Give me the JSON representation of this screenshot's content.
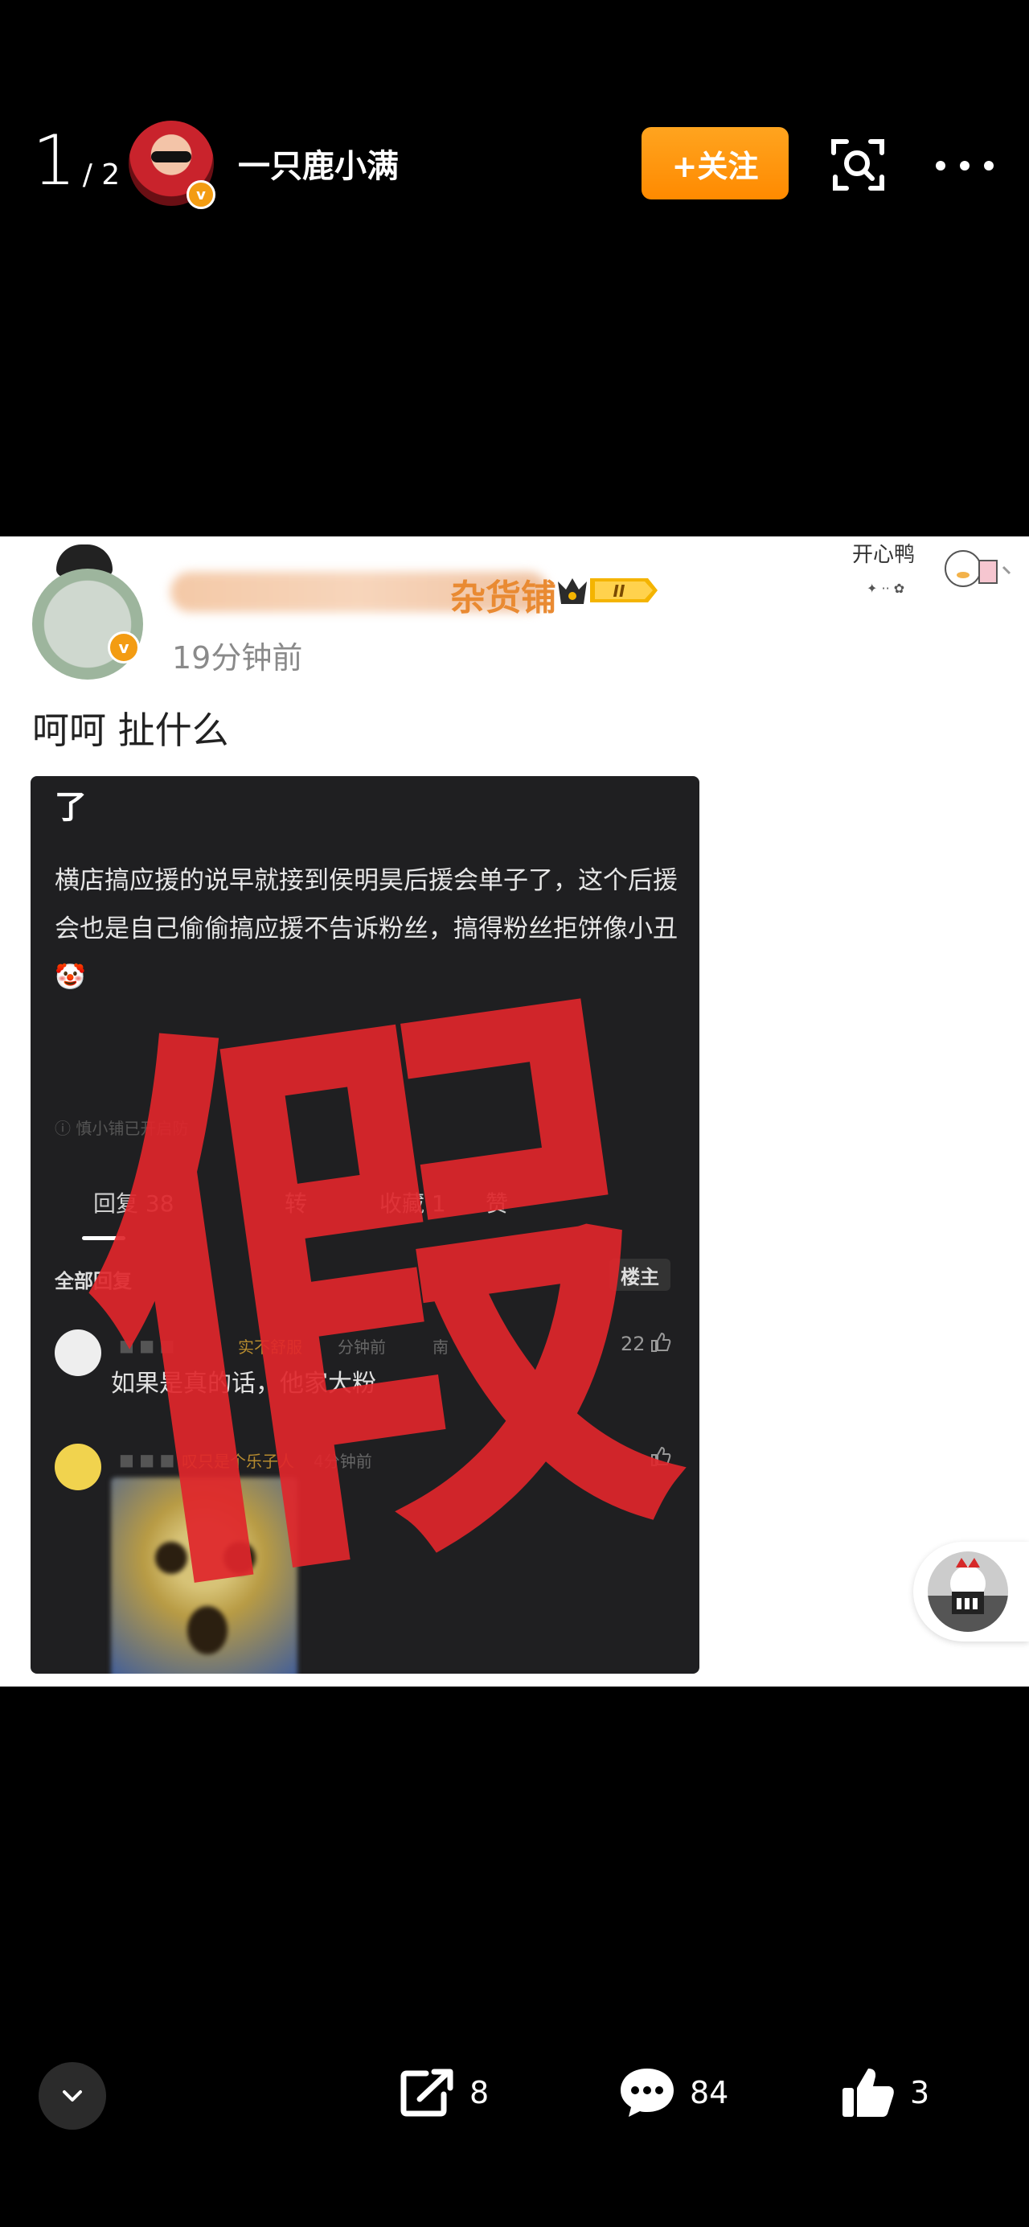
{
  "header": {
    "page_current": "1",
    "page_total": "/ 2",
    "username": "一只鹿小满",
    "follow_label": "+关注",
    "verified_mark": "v",
    "icons": [
      "scan-icon",
      "more-icon"
    ]
  },
  "post": {
    "poster_name_tail": "杂货铺",
    "level_badge": "II",
    "verified_mark": "v",
    "time": "19分钟前",
    "sticker_text": "开心鸭",
    "text": "呵呵 扯什么"
  },
  "screenshot": {
    "top_char": "了",
    "paragraph": "横店搞应援的说早就接到侯明昊后援会单子了，这个后援会也是自己偷偷搞应援不告诉粉丝，搞得粉丝拒饼像小丑🤡",
    "notice": "ⓘ 慎小铺已开启防",
    "tabs": [
      {
        "label": "回复 38"
      },
      {
        "label": "转"
      },
      {
        "label": "收藏 1"
      },
      {
        "label": "赞"
      }
    ],
    "all_replies": "全部回复",
    "louzhu": "楼主",
    "comment1": {
      "tag": "实不舒服",
      "meta": "分钟前",
      "location": "南",
      "text": "如果是真的话，他家大粉",
      "likes": "22"
    },
    "comment2": {
      "tag": "叹只是个乐子人",
      "meta": "4分钟前"
    },
    "stamp_char": "假"
  },
  "actions": {
    "share_count": "8",
    "comment_count": "84",
    "like_count": "3"
  },
  "colors": {
    "accent": "#ff8a00",
    "stamp": "#e0262b",
    "background": "#000000"
  }
}
